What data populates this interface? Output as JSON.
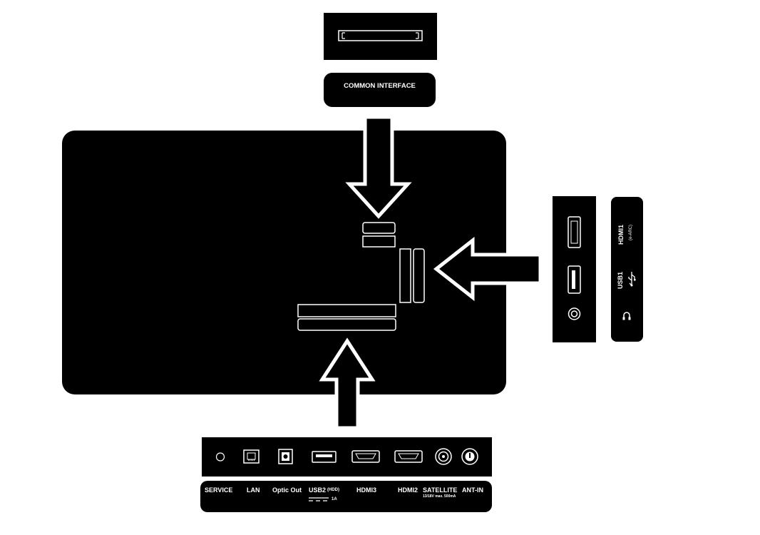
{
  "ci_label": "COMMON INTERFACE",
  "side_panel": {
    "hdmi1_label": "HDMI1",
    "hdmi1_sub": "(e-ARC)",
    "usb1_label": "USB1"
  },
  "bottom_panel": {
    "service": "SERVICE",
    "lan": "LAN",
    "optic_out": "Optic Out",
    "usb2": "USB2",
    "usb2_hdd": "(HDD)",
    "usb2_current": "1A",
    "hdmi3": "HDMI3",
    "hdmi2": "HDMI2",
    "satellite": "SATELLITE",
    "satellite_sub": "13/18V max. 500mA",
    "ant_in": "ANT-IN"
  },
  "colors": {
    "panel": "#000000",
    "background": "#ffffff",
    "label": "#ffffff"
  }
}
